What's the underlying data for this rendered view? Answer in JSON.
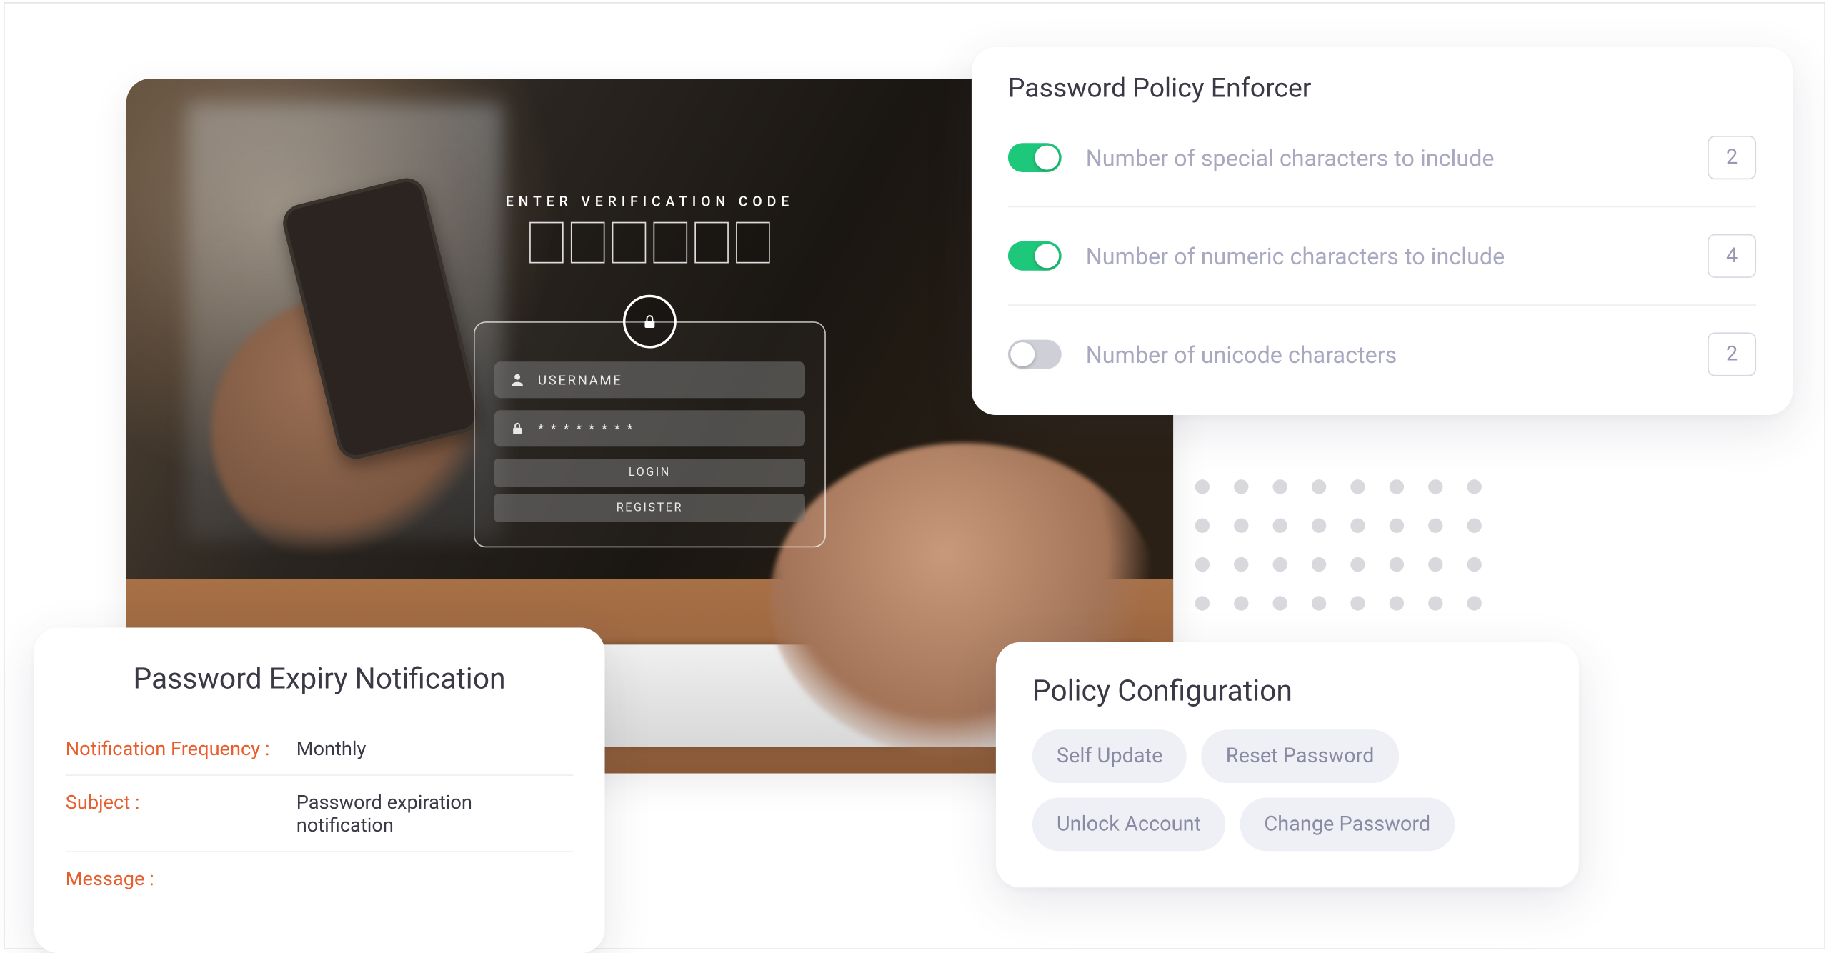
{
  "hero": {
    "verification_label": "ENTER VERIFICATION CODE",
    "username_placeholder": "USERNAME",
    "password_mask": "* * * * * * * *",
    "login_btn": "LOGIN",
    "register_btn": "REGISTER"
  },
  "policy_enforcer": {
    "title": "Password Policy Enforcer",
    "rows": [
      {
        "label": "Number of special characters to include",
        "enabled": true,
        "value": "2"
      },
      {
        "label": "Number of numeric characters to include",
        "enabled": true,
        "value": "4"
      },
      {
        "label": "Number of unicode characters",
        "enabled": false,
        "value": "2"
      }
    ]
  },
  "policy_config": {
    "title": "Policy Configuration",
    "chips": [
      "Self Update",
      "Reset Password",
      "Unlock Account",
      "Change Password"
    ]
  },
  "expiry": {
    "title": "Password Expiry Notification",
    "rows": [
      {
        "key": "Notification Frequency :",
        "value": "Monthly"
      },
      {
        "key": "Subject :",
        "value": "Password expiration notification"
      },
      {
        "key": "Message :",
        "value": ""
      }
    ]
  }
}
